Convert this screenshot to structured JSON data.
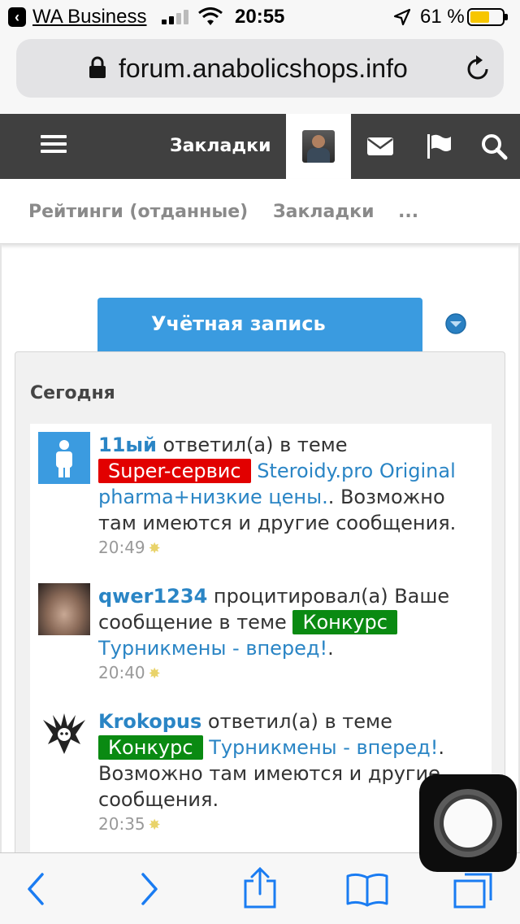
{
  "status_bar": {
    "back_app": "WA Business",
    "time": "20:55",
    "battery_percent": "61 %",
    "battery_level": 0.61
  },
  "browser": {
    "url": "forum.anabolicshops.info"
  },
  "nav": {
    "bookmarks_label": "Закладки"
  },
  "subtabs": [
    "Рейтинги (отданные)",
    "Закладки",
    "..."
  ],
  "account_button": {
    "label": "Учётная запись"
  },
  "panel": {
    "heading": "Сегодня",
    "items": [
      {
        "user": "11ый",
        "action": " ответил(а) в теме ",
        "tag": "Super-сервис",
        "tag_color": "#e20000",
        "link": "Steroidy.pro Original pharma+низкие цены.",
        "suffix": ". Возможно там имеются и другие сообщения.",
        "time": "20:49",
        "avatar_icon": "person-icon"
      },
      {
        "user": "qwer1234",
        "action": " процитировал(а) Ваше сообщение в теме ",
        "tag": "Конкурс",
        "tag_color": "#0a8a12",
        "link": "Турникмены - вперед!",
        "suffix": ".",
        "time": "20:40",
        "avatar_icon": "photo-avatar"
      },
      {
        "user": "Krokopus",
        "action": " ответил(а) в теме ",
        "tag": "Конкурс",
        "tag_color": "#0a8a12",
        "link": "Турникмены - вперед!",
        "suffix": ". Возможно там имеются и другие сообщения.",
        "time": "20:35",
        "avatar_icon": "emblem-avatar"
      }
    ]
  },
  "toolbar": {
    "icons": [
      "back-icon",
      "forward-icon",
      "share-icon",
      "bookmarks-icon",
      "tabs-icon"
    ]
  }
}
